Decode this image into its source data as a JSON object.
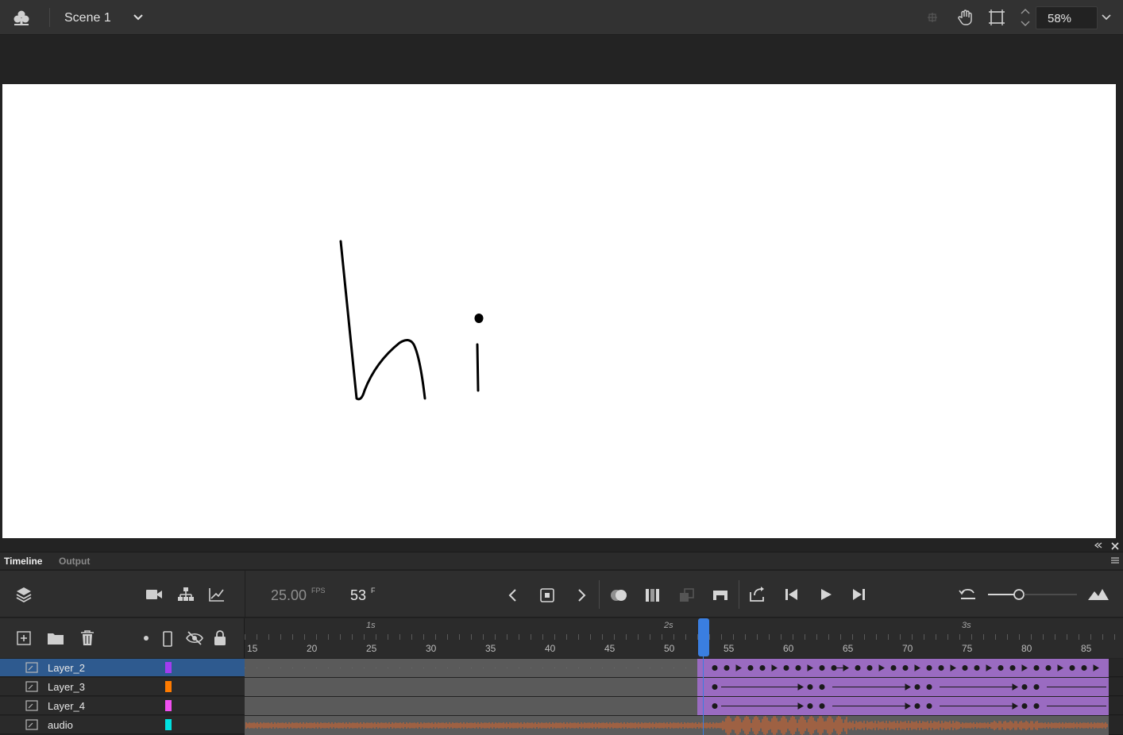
{
  "topbar": {
    "scene": "Scene 1",
    "zoom": "58%"
  },
  "panel": {
    "tabs": [
      "Timeline",
      "Output"
    ],
    "fps_value": "25.00",
    "fps_unit": "FPS",
    "frame_value": "53",
    "frame_unit": "F"
  },
  "ruler": {
    "ticks": [
      "15",
      "20",
      "25",
      "30",
      "35",
      "40",
      "45",
      "50",
      "55",
      "60",
      "65",
      "70",
      "75",
      "80",
      "85"
    ],
    "seconds": [
      "1s",
      "2s",
      "3s"
    ]
  },
  "layers": [
    {
      "name": "Layer_2",
      "color": "#a33cf0",
      "selected": true
    },
    {
      "name": "Layer_3",
      "color": "#ff7b00",
      "selected": false
    },
    {
      "name": "Layer_4",
      "color": "#f050f0",
      "selected": false
    },
    {
      "name": "audio",
      "color": "#00e0e0",
      "selected": false
    }
  ],
  "colors": {
    "accent": "#3a7ee0",
    "frame_span": "#9a6bc1",
    "audio_wave": "#e0662a"
  },
  "playhead_frame": 53
}
